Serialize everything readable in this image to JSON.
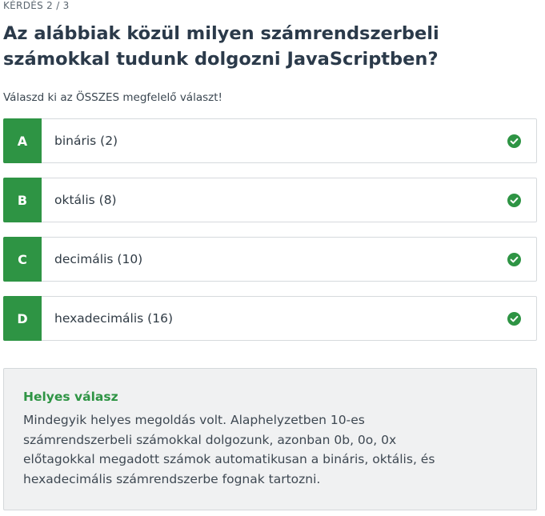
{
  "header": {
    "counter": "KÉRDÉS 2 / 3",
    "question": "Az alábbiak közül milyen számrendszerbeli számokkal tudunk dolgozni JavaScriptben?",
    "instruction": "Válaszd ki az ÖSSZES megfelelő választ!"
  },
  "options": [
    {
      "letter": "A",
      "text": "bináris (2)",
      "icon": "check-circle-icon",
      "correct": true
    },
    {
      "letter": "B",
      "text": "oktális (8)",
      "icon": "check-circle-icon",
      "correct": true
    },
    {
      "letter": "C",
      "text": "decimális (10)",
      "icon": "check-circle-icon",
      "correct": true
    },
    {
      "letter": "D",
      "text": "hexadecimális (16)",
      "icon": "check-circle-icon",
      "correct": true
    }
  ],
  "feedback": {
    "title": "Helyes válasz",
    "text": "Mindegyik helyes megoldás volt. Alaphelyzetben 10-es számrendszerbeli számokkal dolgozunk, azonban 0b, 0o, 0x előtagokkal megadott számok automatikusan a bináris, oktális, és hexadecimális számrendszerbe fognak tartozni."
  },
  "colors": {
    "accent_green": "#2e9444",
    "feedback_bg": "#f0f1f2",
    "border": "#d6dadd"
  }
}
